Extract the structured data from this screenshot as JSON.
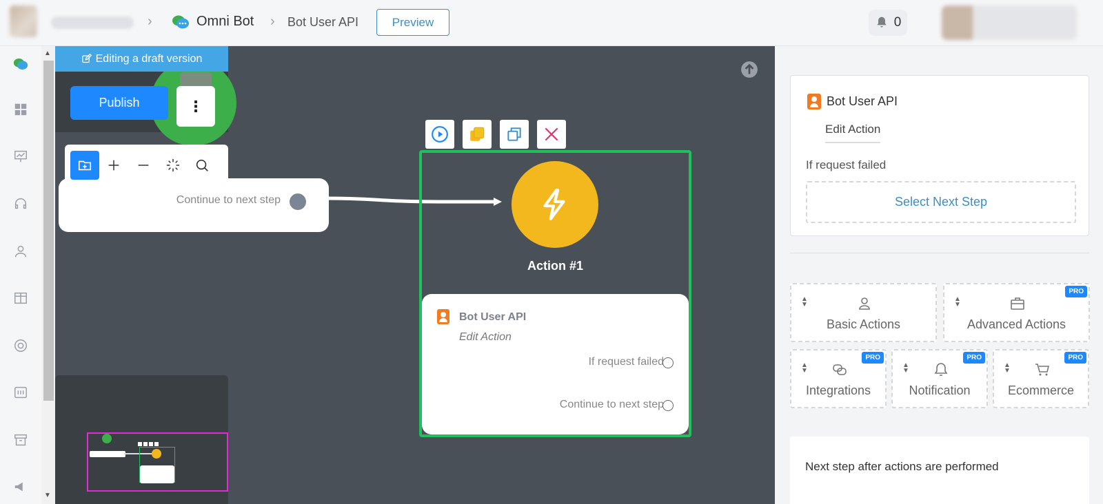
{
  "header": {
    "breadcrumb": [
      "Omni Bot",
      "Bot User API"
    ],
    "preview_label": "Preview",
    "notification_count": "0"
  },
  "canvas": {
    "draft_banner": "Editing a draft version",
    "publish_label": "Publish",
    "start_node_label": "Continue to next step",
    "action_node": {
      "title": "Action #1",
      "card_title": "Bot User API",
      "card_subtitle": "Edit Action",
      "outputs": [
        "If request failed",
        "Continue to next step"
      ]
    }
  },
  "panel": {
    "title": "Bot User API",
    "edit_tab": "Edit Action",
    "failed_label": "If request failed",
    "select_next": "Select Next Step",
    "categories": [
      {
        "label": "Basic Actions",
        "pro": ""
      },
      {
        "label": "Advanced Actions",
        "pro": "PRO"
      },
      {
        "label": "Integrations",
        "pro": "PRO"
      },
      {
        "label": "Notification",
        "pro": "PRO"
      },
      {
        "label": "Ecommerce",
        "pro": "PRO"
      }
    ],
    "next_step_label": "Next step after actions are performed"
  },
  "colors": {
    "accent": "#1e88ff",
    "canvas": "#4a5057",
    "action_yellow": "#f4b81f",
    "selected_green": "#20c05c",
    "link_blue": "#3a8fc7"
  }
}
